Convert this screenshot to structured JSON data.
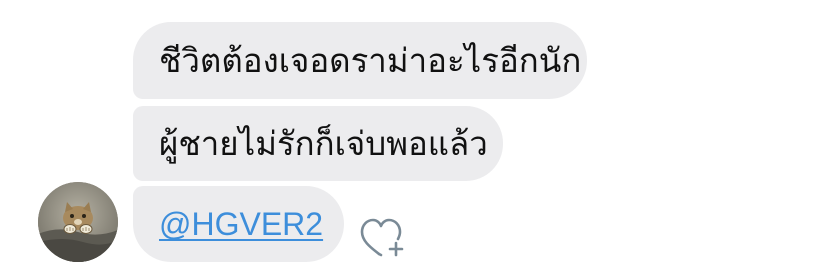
{
  "messages": [
    {
      "text": "ชีวิตต้องเจอดราม่าอะไรอีกนัก"
    },
    {
      "text": "ผู้ชายไม่รักก็เจ่บพอแล้ว"
    },
    {
      "text": "@HGVER2"
    }
  ],
  "sender": {
    "avatar_icon": "cat-avatar"
  },
  "reaction": {
    "icon": "heart-plus-icon"
  },
  "colors": {
    "bubble": "#ECECEE",
    "mention": "#3D8EDB",
    "icon": "#7A8A96"
  }
}
